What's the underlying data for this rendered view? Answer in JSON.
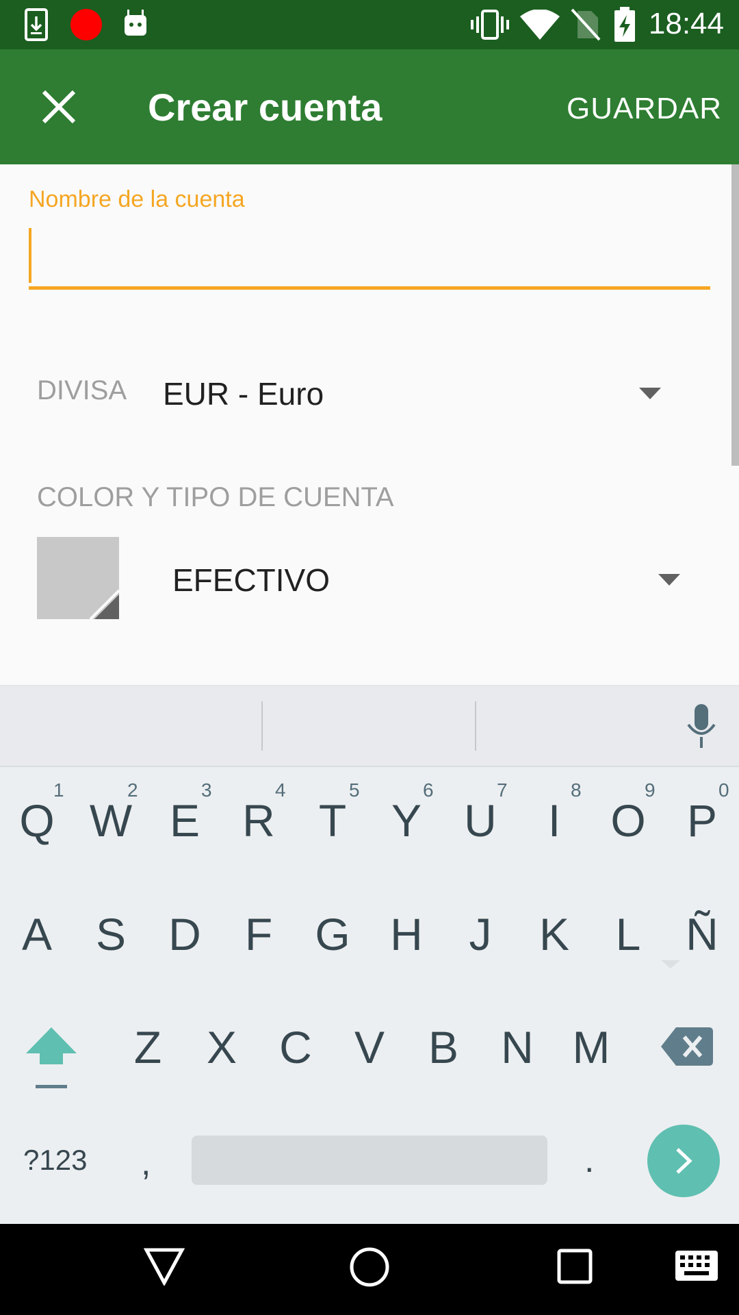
{
  "status_bar": {
    "time": "18:44",
    "icons": [
      "download-icon",
      "record-icon",
      "android-icon",
      "vibrate-icon",
      "wifi-icon",
      "no-sim-icon",
      "battery-charging-icon"
    ]
  },
  "app_bar": {
    "close_icon": "close-icon",
    "title": "Crear cuenta",
    "save_label": "GUARDAR"
  },
  "form": {
    "name_label": "Nombre de la cuenta",
    "name_value": "",
    "currency_label": "DIVISA",
    "currency_value": "EUR - Euro",
    "section_label": "COLOR Y TIPO DE CUENTA",
    "account_type": "EFECTIVO",
    "swatch_color": "#c8c8c8"
  },
  "keyboard": {
    "row1": [
      "Q",
      "W",
      "E",
      "R",
      "T",
      "Y",
      "U",
      "I",
      "O",
      "P"
    ],
    "row1_hints": [
      "1",
      "2",
      "3",
      "4",
      "5",
      "6",
      "7",
      "8",
      "9",
      "0"
    ],
    "row2": [
      "A",
      "S",
      "D",
      "F",
      "G",
      "H",
      "J",
      "K",
      "L",
      "Ñ"
    ],
    "row3": [
      "Z",
      "X",
      "C",
      "V",
      "B",
      "N",
      "M"
    ],
    "symbols_label": "?123",
    "comma": ",",
    "period": ".",
    "accent_color": "#5fbfb1"
  },
  "colors": {
    "status_bar": "#1b5e20",
    "app_bar": "#2e7d32",
    "accent": "#f5a623"
  }
}
